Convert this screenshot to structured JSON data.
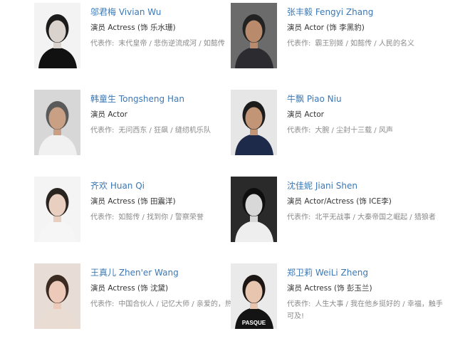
{
  "cast": [
    {
      "name": "邬君梅 Vivian Wu",
      "role": "演员 Actress (饰 乐水珊)",
      "works_label": "代表作:",
      "works": "末代皇帝 / 悲伤逆流成河 / 如懿传",
      "colors": {
        "bg": "#f3f3f3",
        "hair": "#1b1b1b",
        "skin": "#d9d2cd",
        "cloth": "#111111"
      }
    },
    {
      "name": "张丰毅 Fengyi Zhang",
      "role": "演员 Actor (饰 李黑豹)",
      "works_label": "代表作:",
      "works": "霸王别姬 / 如懿传 / 人民的名义",
      "colors": {
        "bg": "#6b6b6b",
        "hair": "#222222",
        "skin": "#b98a6c",
        "cloth": "#2b2b30"
      }
    },
    {
      "name": "韩童生 Tongsheng Han",
      "role": "演员 Actor",
      "works_label": "代表作:",
      "works": "无问西东 / 狂飙 / 缝纫机乐队",
      "colors": {
        "bg": "#d7d7d7",
        "hair": "#5a5a5a",
        "skin": "#c9a083",
        "cloth": "#f1f1f1"
      }
    },
    {
      "name": "牛飘 Piao Niu",
      "role": "演员 Actor",
      "works_label": "代表作:",
      "works": "大腕 / 尘封十三载 / 风声",
      "colors": {
        "bg": "#e6e6e6",
        "hair": "#1c1c1c",
        "skin": "#c29576",
        "cloth": "#1e2a4a"
      }
    },
    {
      "name": "齐欢 Huan Qi",
      "role": "演员 Actress (饰 田震洋)",
      "works_label": "代表作:",
      "works": "如懿传 / 找到你 / 警察荣誉",
      "colors": {
        "bg": "#f4f4f4",
        "hair": "#2a2420",
        "skin": "#e8cfc0",
        "cloth": "#f6f6f6"
      }
    },
    {
      "name": "沈佳妮 Jiani Shen",
      "role": "演员 Actor/Actress (饰 ICE李)",
      "works_label": "代表作:",
      "works": "北平无战事 / 大秦帝国之崛起 / 猎狼者",
      "colors": {
        "bg": "#2a2a2a",
        "hair": "#0e0e0e",
        "skin": "#d8d8d8",
        "cloth": "#eeeeee"
      }
    },
    {
      "name": "王真儿 Zhen'er Wang",
      "role": "演员 Actress (饰 沈黛)",
      "works_label": "代表作:",
      "works": "中国合伙人 / 记忆大师 / 亲爱的，热爱的",
      "colors": {
        "bg": "#e7ddd6",
        "hair": "#3a2a22",
        "skin": "#ecc9b8",
        "cloth": "#e9dcd2"
      }
    },
    {
      "name": "郑卫莉 WeiLi Zheng",
      "role": "演员 Actress (饰 彭玉兰)",
      "works_label": "代表作:",
      "works": "人生大事 / 我在他乡挺好的 / 幸福，触手可及!",
      "shirt_text": "PASQUE",
      "colors": {
        "bg": "#eaeaea",
        "hair": "#1c1714",
        "skin": "#e8c5ae",
        "cloth": "#141414"
      }
    }
  ]
}
